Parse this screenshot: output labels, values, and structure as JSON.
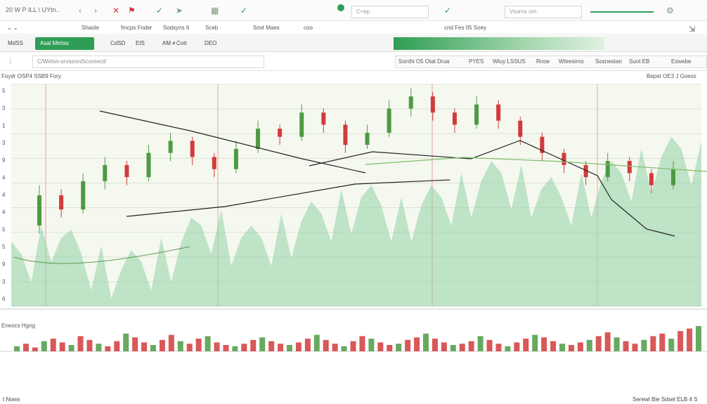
{
  "window": {
    "title": "20 W P ILL \\ UYtn.."
  },
  "topbar": {
    "field_a": "C≈ep",
    "field_b": "Vsorns om"
  },
  "menubar": {
    "items": [
      "Shaole",
      "fmcps Fnder",
      "Sodsyns 6",
      "Sceb",
      "Sovt Maes",
      "coo",
      "cnd Fes 05 Soey"
    ]
  },
  "toolbar": {
    "tabs": [
      "MdSS",
      "Asal Mirtiss",
      "CdSD",
      "EIS",
      "AM ≠",
      "Cotr",
      "DEO"
    ]
  },
  "filterbar": {
    "search_text": "C/Wetsn-urvasors5cuvsecd",
    "options": [
      "Sonthi O5 Otat Drua",
      "PYES",
      "Wtuy LSSUS",
      "Rnoe",
      "Wteesirns",
      "Sosnestan",
      "Suot EB",
      "Eswebe"
    ]
  },
  "chartinfo": {
    "left_label": "Foydr  OSP4  SSB9 Fory",
    "right_label": "Bepet OE3 J Goess"
  },
  "chart_data": {
    "type": "candlestick",
    "price_axis_labels": [
      "5",
      "3",
      "1",
      "3",
      "9",
      "4",
      "4",
      "4",
      "5",
      "5",
      "9",
      "3",
      "6"
    ],
    "volume_label": "Eneocs Hgng",
    "series": [
      {
        "name": "green-area",
        "color": "#2f9d55"
      },
      {
        "name": "bull",
        "color": "#4e9a44"
      },
      {
        "name": "bear",
        "color": "#d23b3b"
      }
    ],
    "area_values": [
      18,
      20,
      22,
      26,
      32,
      28,
      24,
      20,
      18,
      16,
      14,
      12,
      14,
      16,
      18,
      20,
      22,
      26,
      30,
      34,
      36,
      34,
      30,
      28,
      26,
      28,
      30,
      32,
      34,
      36,
      38,
      40,
      42,
      44,
      46,
      48,
      46,
      44,
      42,
      40,
      42,
      44,
      46,
      48,
      50,
      52,
      54,
      56,
      58,
      60,
      58,
      56,
      54,
      52,
      50,
      48,
      50,
      52,
      54,
      56,
      58,
      60,
      62,
      64,
      66,
      68,
      70,
      72,
      70,
      68
    ],
    "candles": [
      {
        "o": 40,
        "c": 55,
        "h": 60,
        "l": 36
      },
      {
        "o": 55,
        "c": 48,
        "h": 58,
        "l": 44
      },
      {
        "o": 48,
        "c": 62,
        "h": 66,
        "l": 46
      },
      {
        "o": 62,
        "c": 70,
        "h": 74,
        "l": 58
      },
      {
        "o": 70,
        "c": 64,
        "h": 72,
        "l": 60
      },
      {
        "o": 64,
        "c": 76,
        "h": 80,
        "l": 62
      },
      {
        "o": 76,
        "c": 82,
        "h": 86,
        "l": 72
      },
      {
        "o": 82,
        "c": 74,
        "h": 84,
        "l": 70
      },
      {
        "o": 74,
        "c": 68,
        "h": 76,
        "l": 64
      },
      {
        "o": 68,
        "c": 78,
        "h": 82,
        "l": 66
      },
      {
        "o": 78,
        "c": 88,
        "h": 92,
        "l": 76
      },
      {
        "o": 88,
        "c": 84,
        "h": 90,
        "l": 80
      },
      {
        "o": 84,
        "c": 96,
        "h": 100,
        "l": 82
      },
      {
        "o": 96,
        "c": 90,
        "h": 98,
        "l": 86
      },
      {
        "o": 90,
        "c": 80,
        "h": 92,
        "l": 76
      },
      {
        "o": 80,
        "c": 86,
        "h": 90,
        "l": 78
      },
      {
        "o": 86,
        "c": 98,
        "h": 102,
        "l": 84
      },
      {
        "o": 98,
        "c": 104,
        "h": 108,
        "l": 94
      },
      {
        "o": 104,
        "c": 96,
        "h": 106,
        "l": 92
      },
      {
        "o": 96,
        "c": 90,
        "h": 98,
        "l": 86
      },
      {
        "o": 90,
        "c": 100,
        "h": 104,
        "l": 88
      },
      {
        "o": 100,
        "c": 92,
        "h": 102,
        "l": 88
      },
      {
        "o": 92,
        "c": 84,
        "h": 94,
        "l": 80
      },
      {
        "o": 84,
        "c": 76,
        "h": 86,
        "l": 72
      },
      {
        "o": 76,
        "c": 70,
        "h": 78,
        "l": 66
      },
      {
        "o": 70,
        "c": 64,
        "h": 72,
        "l": 60
      },
      {
        "o": 64,
        "c": 72,
        "h": 76,
        "l": 62
      },
      {
        "o": 72,
        "c": 66,
        "h": 74,
        "l": 62
      },
      {
        "o": 66,
        "c": 60,
        "h": 68,
        "l": 56
      },
      {
        "o": 60,
        "c": 68,
        "h": 72,
        "l": 58
      }
    ],
    "volume": [
      4,
      6,
      3,
      8,
      10,
      7,
      5,
      12,
      9,
      6,
      4,
      8,
      14,
      11,
      7,
      5,
      9,
      13,
      8,
      6,
      10,
      12,
      7,
      5,
      4,
      6,
      9,
      11,
      8,
      6,
      5,
      7,
      10,
      13,
      9,
      6,
      4,
      8,
      12,
      10,
      7,
      5,
      6,
      9,
      11,
      14,
      10,
      7,
      5,
      6,
      8,
      12,
      9,
      6,
      4,
      7,
      10,
      13,
      11,
      8,
      6,
      5,
      7,
      9,
      12,
      15,
      11,
      8,
      6,
      9,
      12,
      14,
      10,
      16,
      18,
      20
    ],
    "trend_lines": [
      {
        "name": "upper-trendline"
      },
      {
        "name": "lower-trendline"
      },
      {
        "name": "moving-average"
      }
    ]
  },
  "footer": {
    "left": "t   Nows",
    "right": "Serewt Bie Sdsel ELB 4 S"
  },
  "colors": {
    "accent": "#2f9d55",
    "bear": "#d23b3b",
    "bull": "#4e9a44",
    "area": "#8fd1a6"
  }
}
